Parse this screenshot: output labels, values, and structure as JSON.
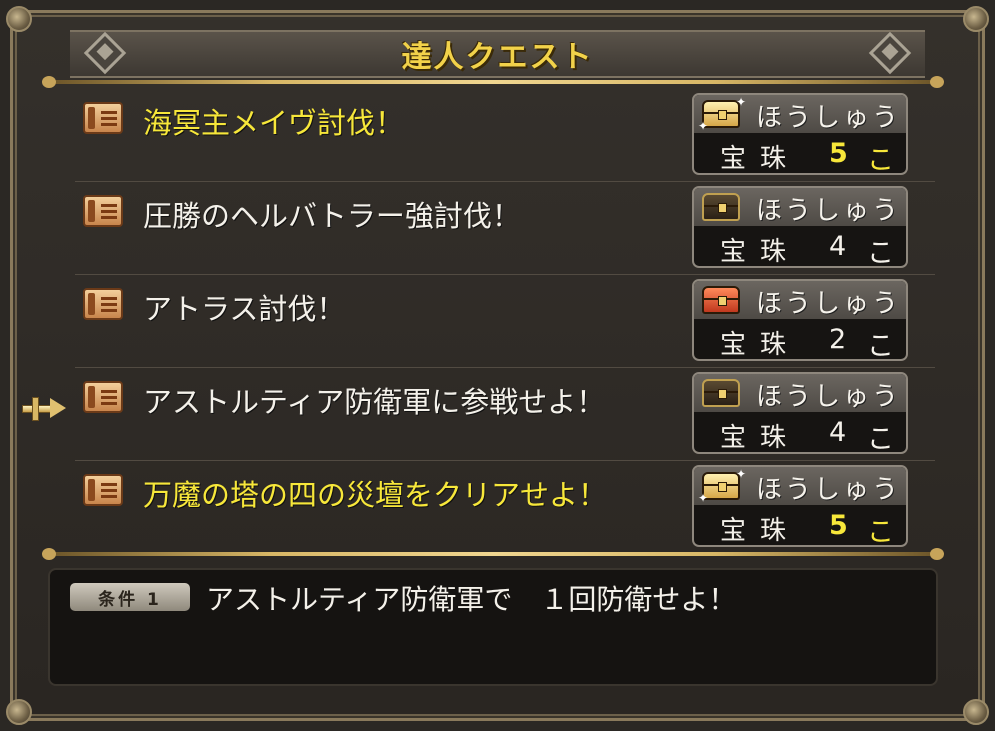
{
  "window": {
    "title": "達人クエスト"
  },
  "quests": [
    {
      "name": "海冥主メイヴ討伐！",
      "highlight": true,
      "reward_label": "ほうしゅう",
      "chest": "gold-chest-icon",
      "reward_item": "宝珠",
      "reward_qty": "5",
      "reward_unit": "こ"
    },
    {
      "name": "圧勝のヘルバトラー強討伐！",
      "highlight": false,
      "reward_label": "ほうしゅう",
      "chest": "dark-chest-icon",
      "reward_item": "宝珠",
      "reward_qty": "4",
      "reward_unit": "こ"
    },
    {
      "name": "アトラス討伐！",
      "highlight": false,
      "reward_label": "ほうしゅう",
      "chest": "red-chest-icon",
      "reward_item": "宝珠",
      "reward_qty": "2",
      "reward_unit": "こ"
    },
    {
      "name": "アストルティア防衛軍に参戦せよ！",
      "highlight": false,
      "selected": true,
      "reward_label": "ほうしゅう",
      "chest": "dark-chest-icon",
      "reward_item": "宝珠",
      "reward_qty": "4",
      "reward_unit": "こ"
    },
    {
      "name": "万魔の塔の四の災壇をクリアせよ！",
      "highlight": true,
      "reward_label": "ほうしゅう",
      "chest": "gold-chest-icon",
      "reward_item": "宝珠",
      "reward_qty": "5",
      "reward_unit": "こ"
    }
  ],
  "condition": {
    "badge": "条件 1",
    "text": "アストルティア防衛軍で　１回防衛せよ！"
  },
  "colors": {
    "highlight_text": "#f7e73a",
    "normal_text": "#f4f1ea",
    "title_text": "#f2d24a",
    "frame_gold": "#d8b766"
  }
}
